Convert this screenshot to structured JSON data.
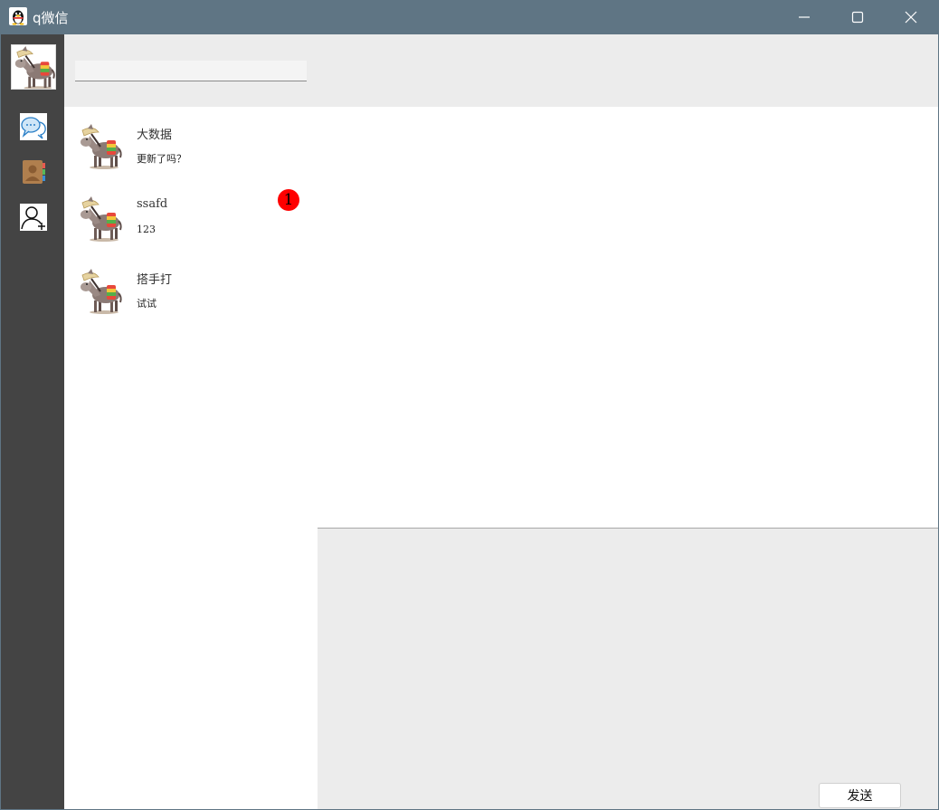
{
  "window": {
    "title": "q微信",
    "icons": {
      "app": "penguin-icon",
      "minimize": "minimize-icon",
      "maximize": "maximize-icon",
      "close": "close-icon"
    }
  },
  "nav": {
    "items": [
      {
        "icon": "chat-bubbles-icon"
      },
      {
        "icon": "contacts-book-icon"
      },
      {
        "icon": "add-friend-icon"
      }
    ]
  },
  "search": {
    "value": "",
    "placeholder": ""
  },
  "contacts": [
    {
      "name": "大数据",
      "last_message": "更新了吗？",
      "unread": ""
    },
    {
      "name": "ssafd",
      "last_message": "123",
      "unread": "1"
    },
    {
      "name": "搭手打",
      "last_message": "试试",
      "unread": ""
    }
  ],
  "composer": {
    "value": "",
    "send_label": "发送"
  },
  "colors": {
    "titlebar": "#5f7584",
    "navbar": "#444444",
    "panel_gray": "#ececec",
    "badge": "#ff0000"
  }
}
